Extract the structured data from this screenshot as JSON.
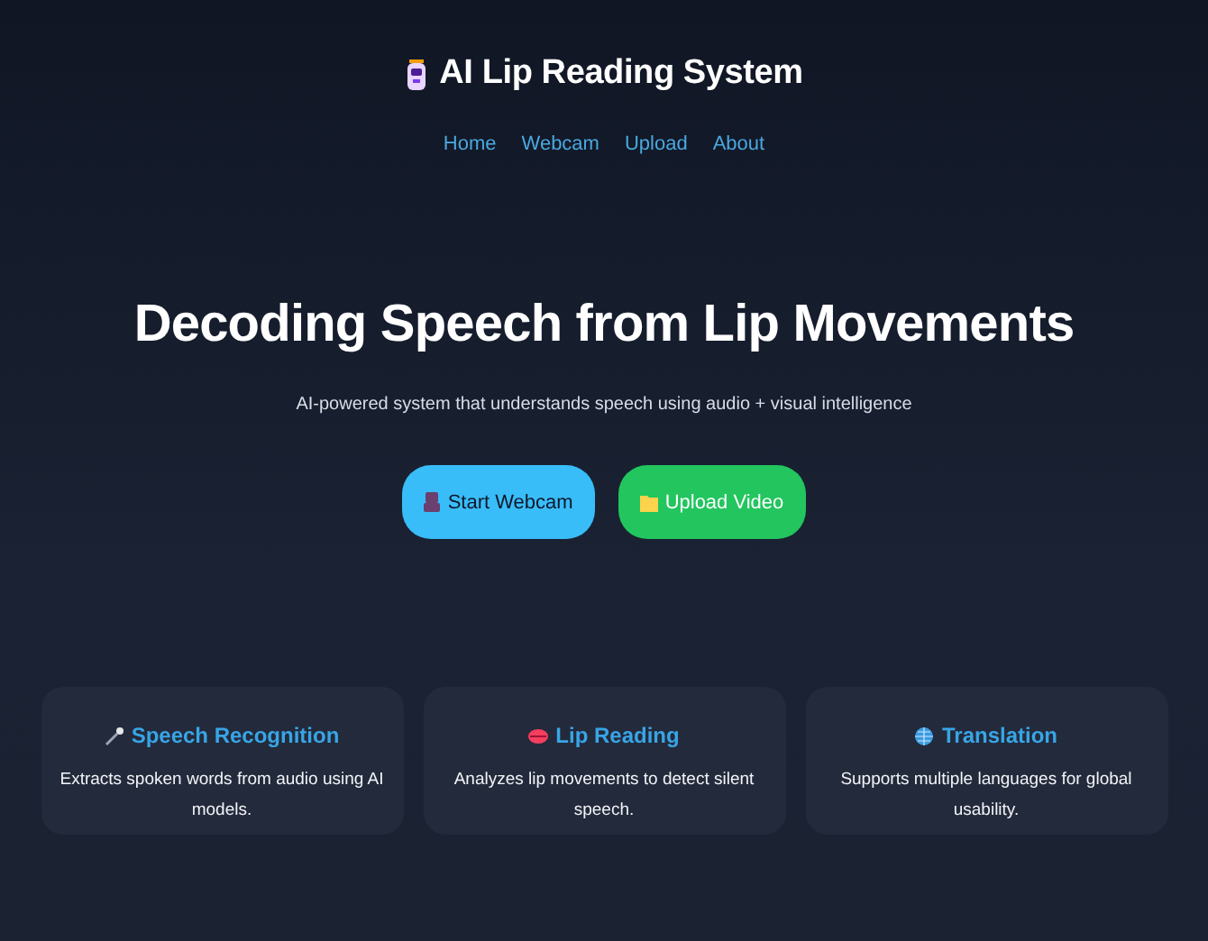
{
  "header": {
    "title": "AI Lip Reading System",
    "nav": [
      {
        "label": "Home"
      },
      {
        "label": "Webcam"
      },
      {
        "label": "Upload"
      },
      {
        "label": "About"
      }
    ]
  },
  "hero": {
    "heading": "Decoding Speech from Lip Movements",
    "subtitle": "AI-powered system that understands speech using audio + visual intelligence",
    "buttons": [
      {
        "label": "Start Webcam",
        "kind": "webcam"
      },
      {
        "label": "Upload Video",
        "kind": "upload"
      }
    ]
  },
  "features": [
    {
      "kind": "mic",
      "title": "Speech Recognition",
      "text": "Extracts spoken words from audio using AI models."
    },
    {
      "kind": "lips",
      "title": "Lip Reading",
      "text": "Analyzes lip movements to detect silent speech."
    },
    {
      "kind": "globe",
      "title": "Translation",
      "text": "Supports multiple languages for global usability."
    }
  ]
}
